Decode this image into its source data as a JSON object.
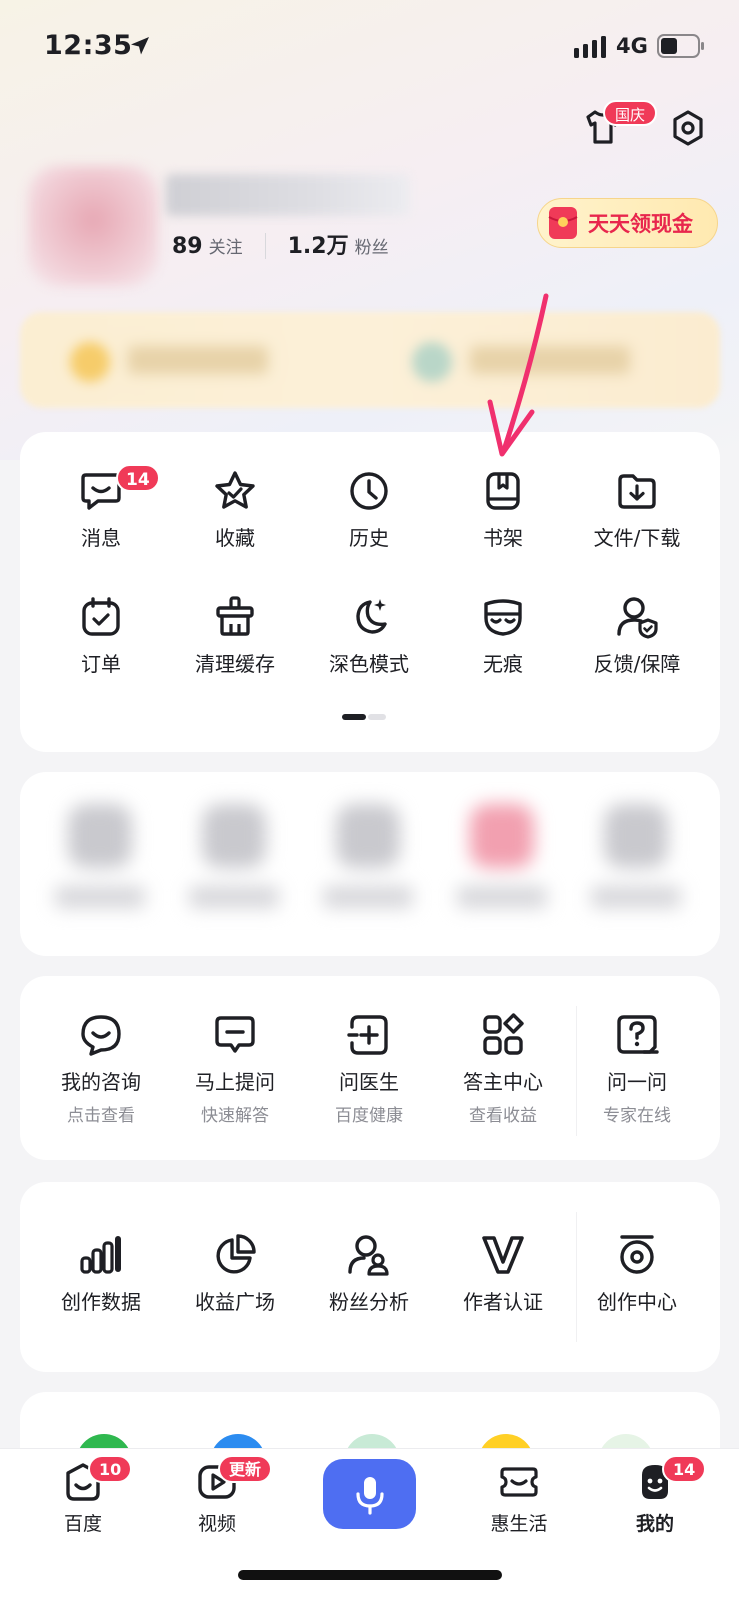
{
  "status_bar": {
    "time": "12:35",
    "network": "4G"
  },
  "header": {
    "holiday_badge": "国庆"
  },
  "profile": {
    "following_count": "89",
    "following_label": "关注",
    "fans_count": "1.2万",
    "fans_label": "粉丝",
    "cash_button": "天天领现金"
  },
  "tools": {
    "row1": [
      {
        "label": "消息",
        "icon": "message-icon",
        "badge": "14"
      },
      {
        "label": "收藏",
        "icon": "star-icon"
      },
      {
        "label": "历史",
        "icon": "clock-icon"
      },
      {
        "label": "书架",
        "icon": "bookshelf-icon"
      },
      {
        "label": "文件/下载",
        "icon": "download-folder-icon"
      }
    ],
    "row2": [
      {
        "label": "订单",
        "icon": "order-icon"
      },
      {
        "label": "清理缓存",
        "icon": "clean-icon"
      },
      {
        "label": "深色模式",
        "icon": "moon-icon"
      },
      {
        "label": "无痕",
        "icon": "mask-icon"
      },
      {
        "label": "反馈/保障",
        "icon": "feedback-shield-icon"
      }
    ]
  },
  "health": [
    {
      "label": "我的咨询",
      "sub": "点击查看",
      "icon": "consult-icon"
    },
    {
      "label": "马上提问",
      "sub": "快速解答",
      "icon": "ask-icon"
    },
    {
      "label": "问医生",
      "sub": "百度健康",
      "icon": "doctor-icon"
    },
    {
      "label": "答主中心",
      "sub": "查看收益",
      "icon": "grid-apps-icon"
    },
    {
      "label": "问一问",
      "sub": "专家在线",
      "icon": "question-icon"
    }
  ],
  "creator": [
    {
      "label": "创作数据",
      "icon": "bar-chart-icon"
    },
    {
      "label": "收益广场",
      "icon": "pie-chart-icon"
    },
    {
      "label": "粉丝分析",
      "icon": "fans-icon"
    },
    {
      "label": "作者认证",
      "icon": "v-badge-icon"
    },
    {
      "label": "创作中心",
      "icon": "camera-icon"
    }
  ],
  "tabbar": {
    "tabs": [
      {
        "label": "百度",
        "badge": "10",
        "icon": "baidu-icon"
      },
      {
        "label": "视频",
        "badge": "更新",
        "icon": "video-icon"
      },
      {
        "label": "惠生活",
        "icon": "ticket-icon"
      },
      {
        "label": "我的",
        "badge": "14",
        "icon": "me-icon"
      }
    ]
  },
  "colors": {
    "accent": "#4e6ef2",
    "badge": "#f03a58",
    "arrow": "#f0306e"
  }
}
